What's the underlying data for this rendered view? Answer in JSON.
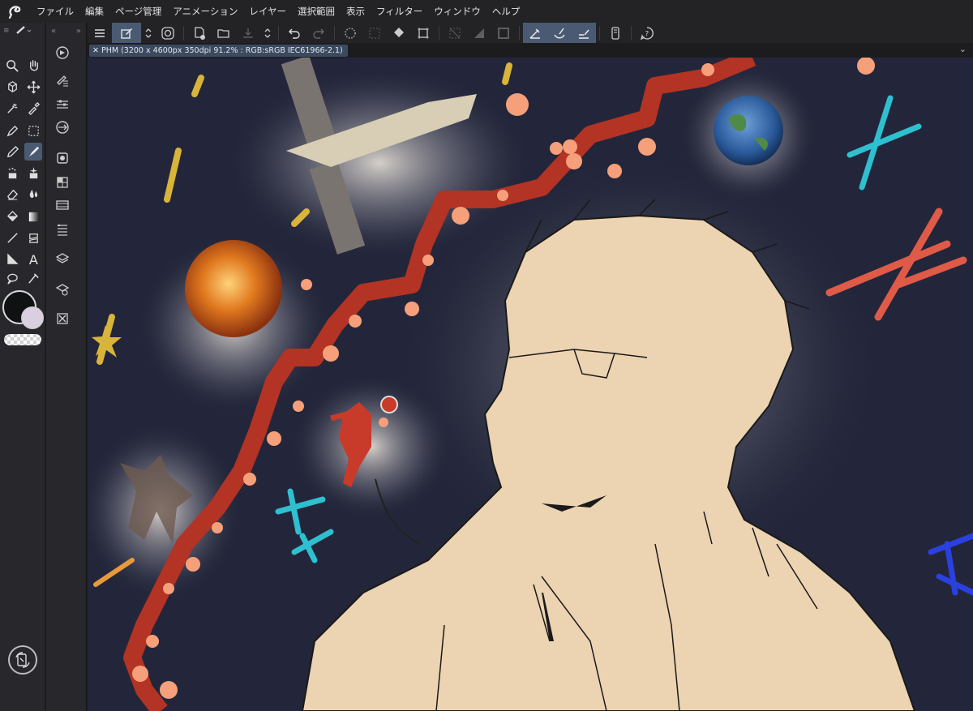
{
  "menu": [
    "ファイル",
    "編集",
    "ページ管理",
    "アニメーション",
    "レイヤー",
    "選択範囲",
    "表示",
    "フィルター",
    "ウィンドウ",
    "ヘルプ"
  ],
  "document_tab": "PHM (3200 x 4600px 350dpi 91.2% : RGB:sRGB IEC61966-2.1)",
  "colors": {
    "main_color": "#101113",
    "sub_color": "#d9cfe0",
    "accent_active": "#4a5a72",
    "canvas_bg": "#23263a",
    "skin": "#ecd3b1",
    "ribbon": "#b33324",
    "dot": "#f5a07a"
  },
  "tool_icons": [
    "zoom-icon",
    "hand-icon",
    "operation-icon",
    "move-icon",
    "auto-select-icon",
    "eyedropper-icon",
    "pen-icon",
    "selection-icon",
    "pencil-icon",
    "brush-icon",
    "airbrush-icon",
    "decoration-icon",
    "eraser-icon",
    "blend-icon",
    "fill-icon",
    "gradient-icon",
    "figure-icon",
    "frame-icon",
    "ruler-icon",
    "text-icon",
    "balloon-icon",
    "correct-line-icon"
  ],
  "palette_icons": [
    "navigator-icon",
    "tool-property-icon",
    "sub-tool-detail-icon",
    "color-wheel-icon",
    "color-set-icon",
    "material-icon",
    "timeline-icon",
    "layer-property-icon",
    "layer-icon",
    "layer-search-icon",
    "close-panel-icon"
  ],
  "command_icons": [
    "main-menu-icon",
    "edit-mode-icon",
    "stepper-icon",
    "spiral-icon",
    "new-icon",
    "open-icon",
    "save-icon",
    "stepper-icon-2",
    "undo-icon",
    "redo-icon",
    "loading-icon",
    "clear-icon",
    "fill-icon-cmd",
    "transform-icon",
    "deselect-icon",
    "invert-icon",
    "snap-icon",
    "snap-ruler-icon",
    "snap-special-icon",
    "snap-grid-icon",
    "smartphone-icon",
    "help-icon"
  ]
}
